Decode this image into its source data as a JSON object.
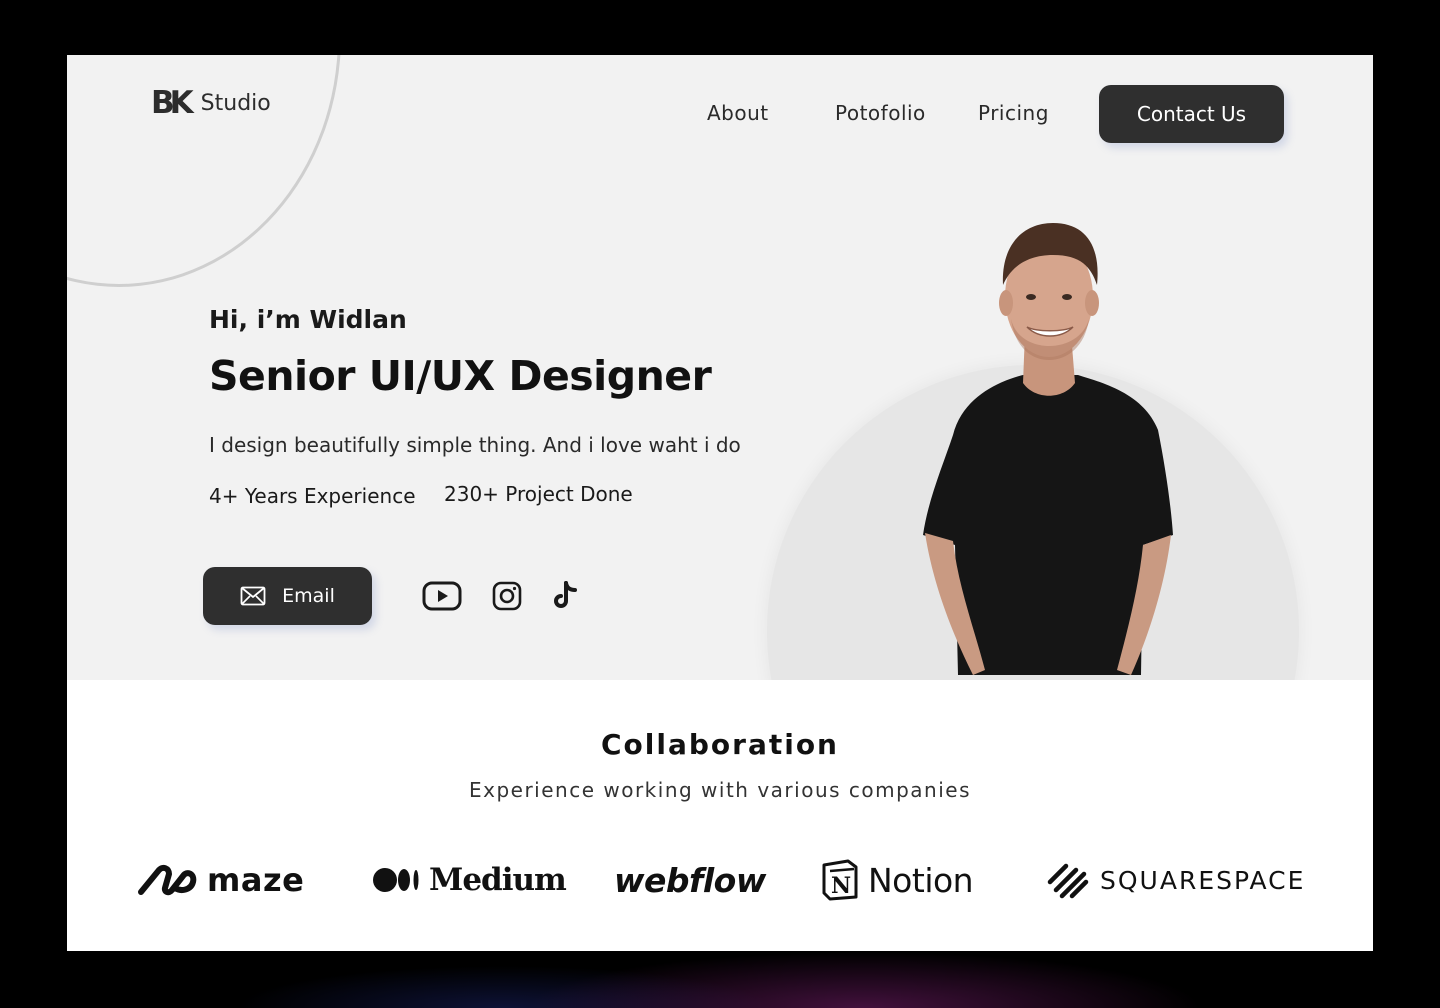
{
  "logo": {
    "mark": "BK",
    "text": "Studio"
  },
  "nav": {
    "items": [
      "About",
      "Potofolio",
      "Pricing"
    ],
    "cta": "Contact Us"
  },
  "hero": {
    "greeting": "Hi, i’m Widlan",
    "headline": "Senior UI/UX Designer",
    "tagline": "I design beautifully simple thing. And i love waht i do",
    "stats": [
      "4+ Years Experience",
      "230+ Project Done"
    ],
    "email_label": "Email",
    "socials": [
      "youtube-icon",
      "instagram-icon",
      "tiktok-icon"
    ]
  },
  "collaboration": {
    "title": "Collaboration",
    "subtitle": "Experience working with various companies",
    "brands": [
      "maze",
      "Medium",
      "webflow",
      "Notion",
      "SQUARESPACE"
    ]
  },
  "colors": {
    "hero_bg": "#f2f2f2",
    "button_bg": "#2f2f2f",
    "text": "#111111"
  }
}
